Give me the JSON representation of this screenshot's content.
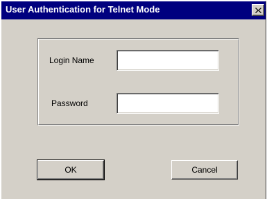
{
  "window": {
    "title": "User Authentication for Telnet Mode",
    "close_icon": "close-icon"
  },
  "form": {
    "login_name_label": "Login Name",
    "login_name_value": "",
    "password_label": "Password",
    "password_value": ""
  },
  "buttons": {
    "ok_label": "OK",
    "cancel_label": "Cancel"
  },
  "colors": {
    "titlebar": "#00007f",
    "face": "#d4d0c8"
  }
}
